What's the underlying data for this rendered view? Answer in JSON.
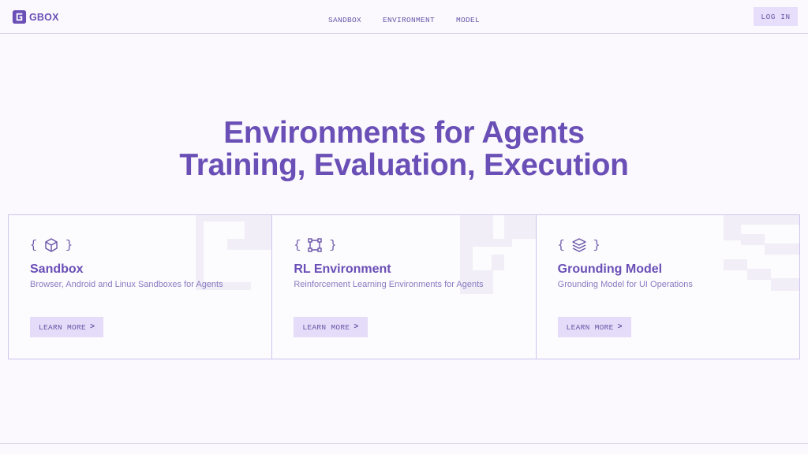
{
  "header": {
    "logo_text": "GBOX",
    "nav": [
      "SANDBOX",
      "ENVIRONMENT",
      "MODEL"
    ],
    "login_label": "LOG IN"
  },
  "hero": {
    "line1": "Environments for Agents",
    "line2": "Training, Evaluation, Execution"
  },
  "cards": [
    {
      "icon": "cube-icon",
      "title": "Sandbox",
      "description": "Browser, Android and Linux Sandboxes for Agents",
      "button": "LEARN MORE"
    },
    {
      "icon": "network-icon",
      "title": "RL Environment",
      "description": "Reinforcement Learning Environments for Agents",
      "button": "LEARN MORE"
    },
    {
      "icon": "layers-icon",
      "title": "Grounding Model",
      "description": "Grounding Model for UI Operations",
      "button": "LEARN MORE"
    }
  ],
  "braces": {
    "open": "{",
    "close": "}"
  },
  "arrow": ">",
  "colors": {
    "accent": "#6a4fb6",
    "button_bg": "#e4dcf8",
    "border": "#cfc4ee",
    "background": "#fbf9fe"
  }
}
